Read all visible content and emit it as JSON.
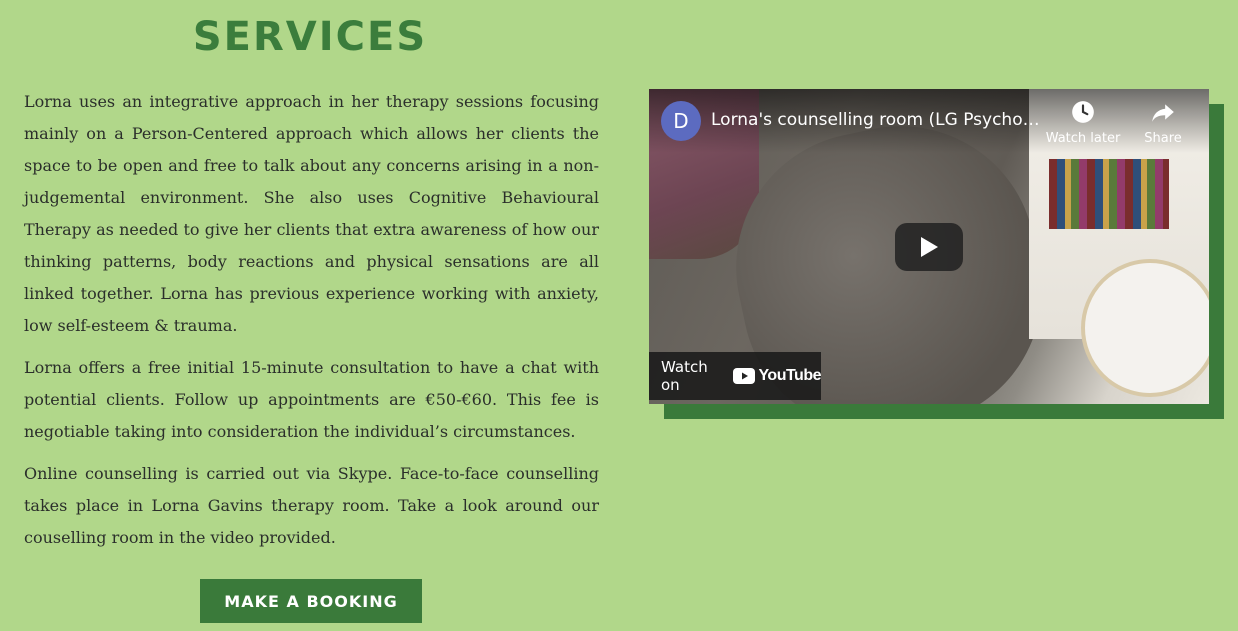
{
  "section": {
    "heading": "SERVICES",
    "paragraphs": [
      "Lorna uses an integrative approach in her therapy sessions focusing mainly on a Person-Centered approach which allows her clients the space to be open and free to talk about any concerns arising in a non-judgemental environment. She also uses Cognitive Behavioural Therapy as needed to give her clients that extra awareness of how our thinking patterns, body reactions and physical sensations are all linked together. Lorna has previous experience working with anxiety, low self-esteem & trauma.",
      "Lorna offers a free initial 15-minute consultation to have a chat with potential clients. Follow up appointments are €50-€60. This fee is negotiable taking into consideration the individual’s circumstances.",
      "Online counselling is carried out via Skype. Face-to-face counselling takes place in Lorna Gavins therapy room. Take a look around our couselling room in the video provided."
    ],
    "button_label": "MAKE A BOOKING"
  },
  "video": {
    "channel_initial": "D",
    "title": "Lorna's counselling room (LG Psychotherapy)",
    "watch_later_label": "Watch later",
    "share_label": "Share",
    "watch_on_label": "Watch on",
    "platform_name": "YouTube",
    "icons": {
      "watch_later": "clock-icon",
      "share": "share-arrow-icon",
      "play": "play-icon",
      "logo": "youtube-logo-icon"
    }
  },
  "colors": {
    "background": "#b1d78a",
    "accent_green": "#3a7a3a",
    "heading_green": "#3b7d3c",
    "avatar": "#5c6bc0"
  }
}
